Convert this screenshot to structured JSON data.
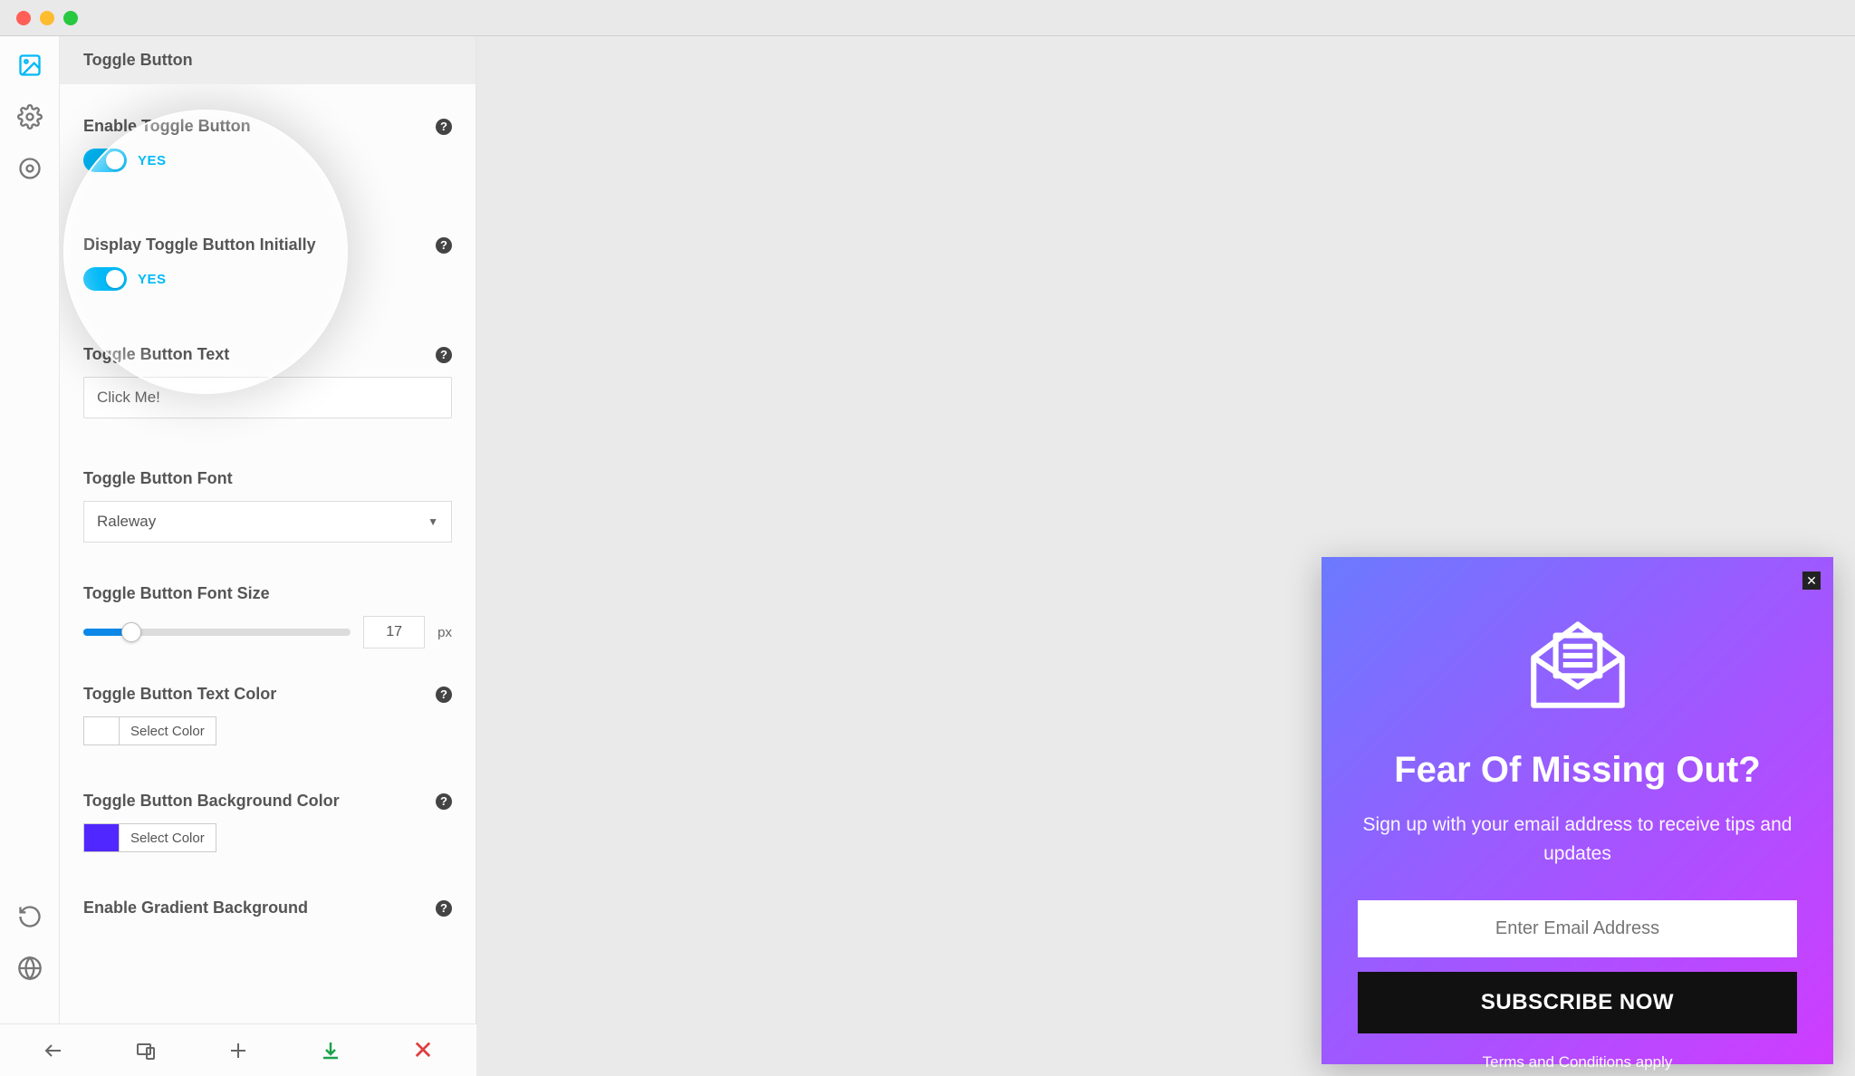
{
  "window": {
    "os": "mac"
  },
  "rail": {
    "items": [
      {
        "name": "design-tab",
        "icon": "image-icon",
        "active": true
      },
      {
        "name": "settings-tab",
        "icon": "gear-icon",
        "active": false
      },
      {
        "name": "target-tab",
        "icon": "target-icon",
        "active": false
      }
    ],
    "bottom": [
      {
        "name": "history-button",
        "icon": "history-icon"
      },
      {
        "name": "globe-button",
        "icon": "globe-icon"
      }
    ]
  },
  "panel": {
    "header": "Toggle Button",
    "enable_toggle": {
      "label": "Enable Toggle Button",
      "value": "YES",
      "on": true
    },
    "display_initially": {
      "label": "Display Toggle Button Initially",
      "value": "YES",
      "on": true
    },
    "button_text": {
      "label": "Toggle Button Text",
      "value": "Click Me!"
    },
    "font": {
      "label": "Toggle Button Font",
      "value": "Raleway"
    },
    "font_size": {
      "label": "Toggle Button Font Size",
      "value": "17",
      "unit": "px",
      "percent": 18
    },
    "text_color": {
      "label": "Toggle Button Text Color",
      "button": "Select Color",
      "swatch": ""
    },
    "bg_color": {
      "label": "Toggle Button Background Color",
      "button": "Select Color",
      "swatch": "#5028ff"
    },
    "gradient": {
      "label": "Enable Gradient Background"
    }
  },
  "footer": {
    "back": "back-icon",
    "responsive": "device-icon",
    "add": "plus-icon",
    "download": "download-icon",
    "close": "close-icon"
  },
  "popup": {
    "title": "Fear Of Missing Out?",
    "subtitle": "Sign up with your email address to receive tips and updates",
    "email_placeholder": "Enter Email Address",
    "button": "SUBSCRIBE NOW",
    "terms": "Terms and Conditions apply"
  }
}
